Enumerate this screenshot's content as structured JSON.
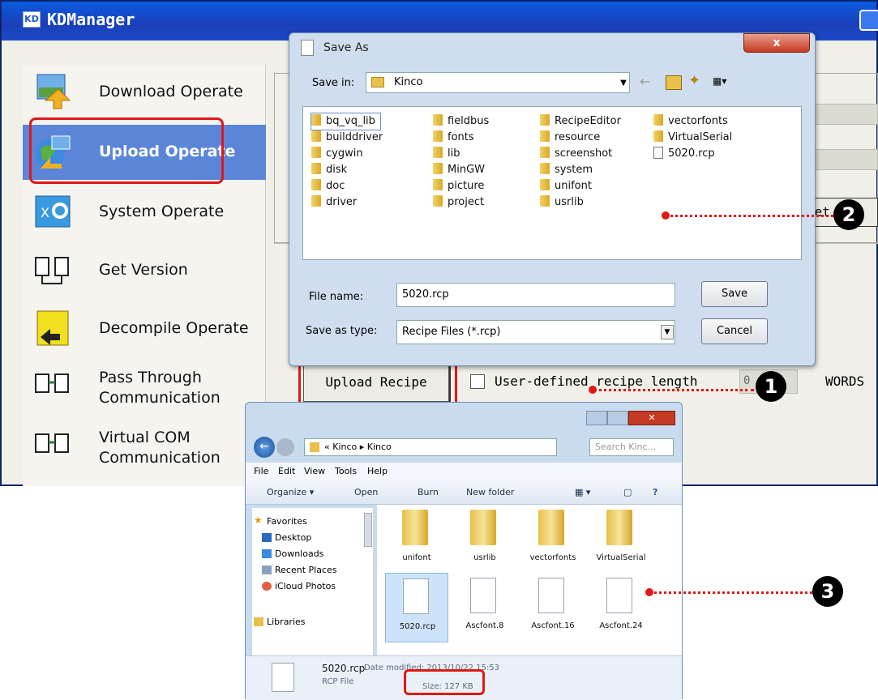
{
  "kdmanager": {
    "title": "KDManager",
    "nav": [
      {
        "label": "Download Operate"
      },
      {
        "label": "Upload Operate"
      },
      {
        "label": "System Operate"
      },
      {
        "label": "Get Version"
      },
      {
        "label": "Decompile Operate"
      },
      {
        "label1": "Pass Through",
        "label2": "Communication"
      },
      {
        "label1": "Virtual COM",
        "label2": "Communication"
      }
    ],
    "set_button": "Set",
    "upload_recipe": "Upload Recipe",
    "user_defined_label": "User-defined recipe length",
    "recipe_length_value": "0",
    "words_unit": "WORDS"
  },
  "save_as": {
    "title": "Save As",
    "close": "x",
    "save_in_label": "Save in:",
    "save_in_value": "Kinco",
    "files": [
      "bq_vq_lib",
      "builddriver",
      "cygwin",
      "disk",
      "doc",
      "driver",
      "fieldbus",
      "fonts",
      "lib",
      "MinGW",
      "picture",
      "project",
      "RecipeEditor",
      "resource",
      "screenshot",
      "system",
      "unifont",
      "usrlib",
      "vectorfonts",
      "VirtualSerial",
      "5020.rcp"
    ],
    "file_name_label": "File name:",
    "file_name_value": "5020.rcp",
    "save_type_label": "Save as type:",
    "save_type_value": "Recipe Files (*.rcp)",
    "save_button": "Save",
    "cancel_button": "Cancel"
  },
  "explorer": {
    "address": "« Kinco ▸ Kinco",
    "search_placeholder": "Search Kinc...",
    "menu": [
      "File",
      "Edit",
      "View",
      "Tools",
      "Help"
    ],
    "toolbar": [
      "Organize ▾",
      "Open",
      "Burn",
      "New folder"
    ],
    "nav": [
      "Favorites",
      "Desktop",
      "Downloads",
      "Recent Places",
      "iCloud Photos",
      "Libraries"
    ],
    "items": [
      "unifont",
      "usrlib",
      "vectorfonts",
      "VirtualSerial",
      "5020.rcp",
      "Ascfont.8",
      "Ascfont.16",
      "Ascfont.24"
    ],
    "status_name": "5020.rcp",
    "status_modified": "Date modified: 2013/10/22 15:53",
    "status_type": "RCP File",
    "status_size": "Size: 127 KB"
  },
  "callouts": [
    "1",
    "2",
    "3"
  ],
  "colors": {
    "highlight": "#e01818",
    "titlebar": "#1c3fb8",
    "selected_nav": "#5b86d8"
  }
}
